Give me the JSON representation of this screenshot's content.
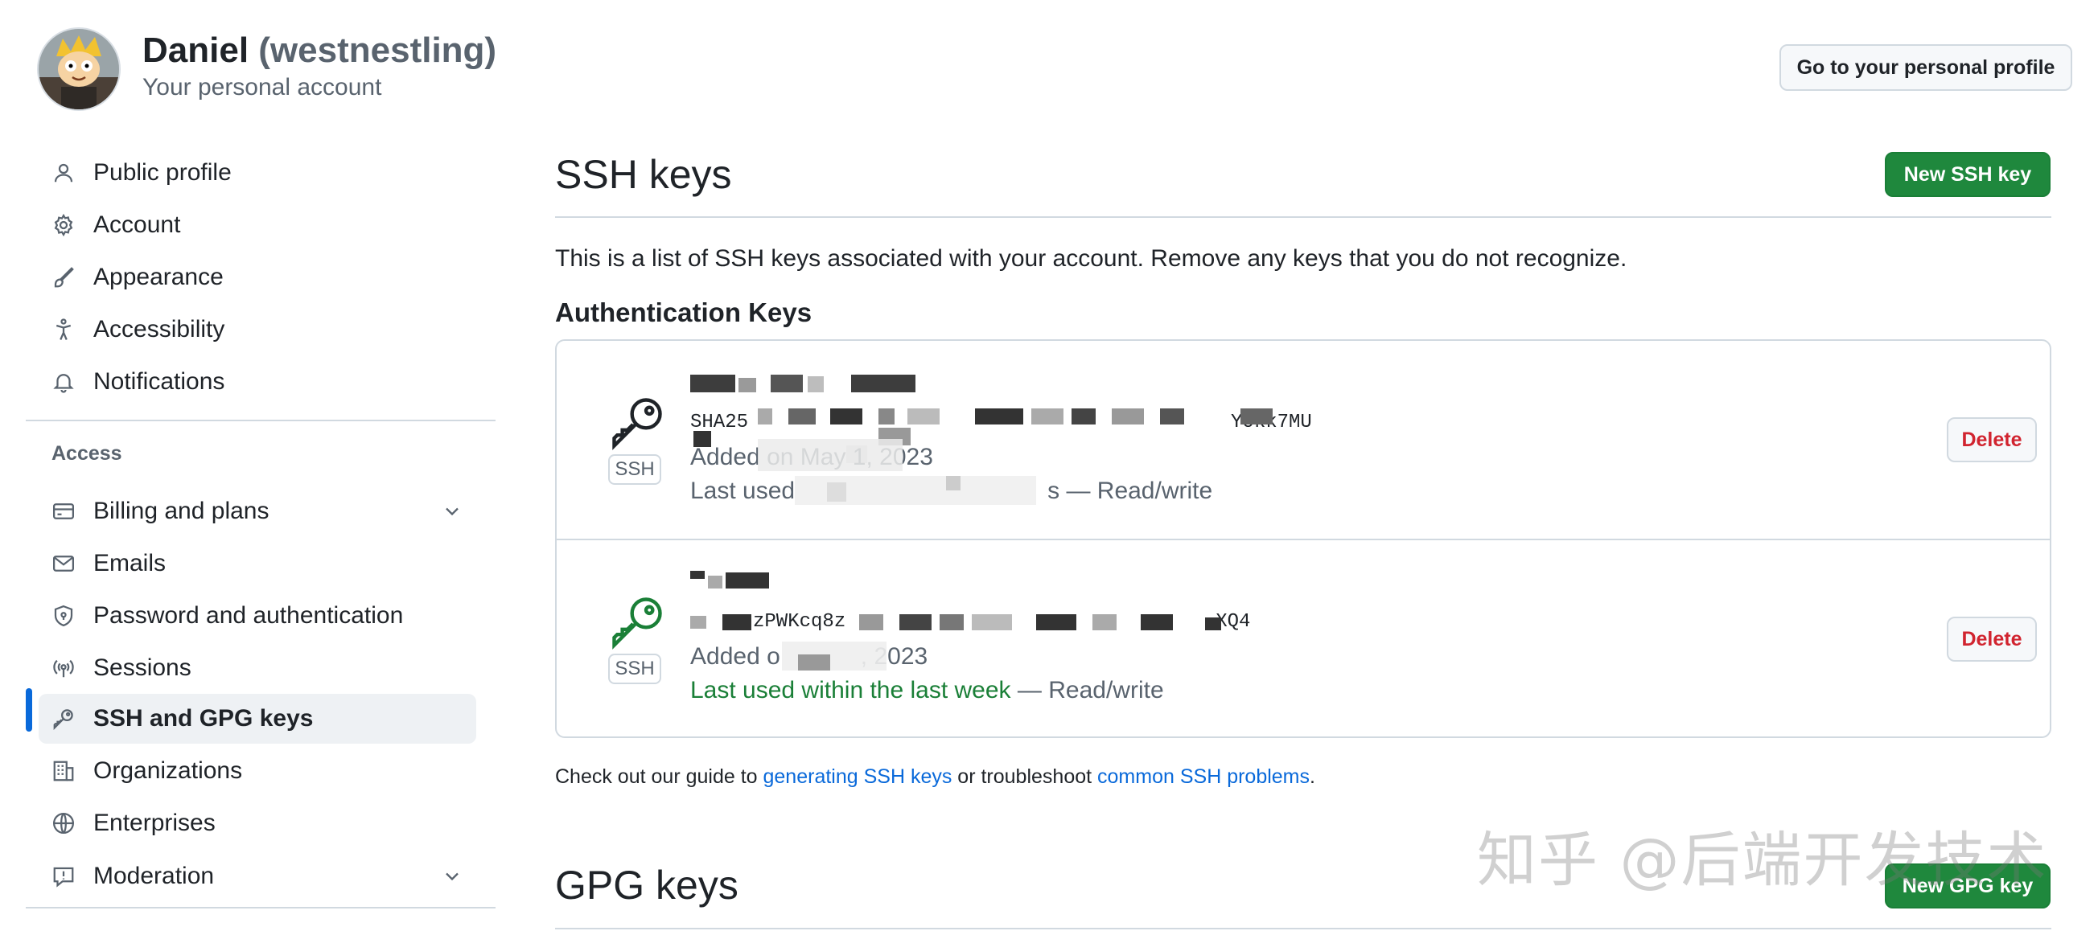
{
  "header": {
    "user_name": "Daniel",
    "user_handle": "(westnestling)",
    "account_type": "Your personal account",
    "profile_button": "Go to your personal profile"
  },
  "sidebar": {
    "items": [
      {
        "label": "Public profile",
        "icon": "person-icon"
      },
      {
        "label": "Account",
        "icon": "gear-icon"
      },
      {
        "label": "Appearance",
        "icon": "paintbrush-icon"
      },
      {
        "label": "Accessibility",
        "icon": "accessibility-icon"
      },
      {
        "label": "Notifications",
        "icon": "bell-icon"
      }
    ],
    "access_heading": "Access",
    "access_items": [
      {
        "label": "Billing and plans",
        "icon": "credit-card-icon"
      },
      {
        "label": "Emails",
        "icon": "mail-icon"
      },
      {
        "label": "Password and authentication",
        "icon": "shield-lock-icon"
      },
      {
        "label": "Sessions",
        "icon": "broadcast-icon"
      },
      {
        "label": "SSH and GPG keys",
        "icon": "key-icon"
      },
      {
        "label": "Organizations",
        "icon": "organization-icon"
      },
      {
        "label": "Enterprises",
        "icon": "globe-icon"
      },
      {
        "label": "Moderation",
        "icon": "report-icon"
      }
    ]
  },
  "main": {
    "ssh_title": "SSH keys",
    "new_ssh_button": "New SSH key",
    "description": "This is a list of SSH keys associated with your account. Remove any keys that you do not recognize.",
    "auth_heading": "Authentication Keys",
    "keys": [
      {
        "badge": "SSH",
        "fingerprint_visible": "SHA25",
        "fingerprint_tail": "Yokk7MU",
        "added": "Added on May 1, 2023",
        "last_used": "Last used",
        "last_used_tail": "s",
        "access": "— Read/write",
        "delete_label": "Delete"
      },
      {
        "badge": "SSH",
        "fingerprint_visible": "zPWKcq8z",
        "fingerprint_tail": "XQ4",
        "added": "Added o",
        "added_tail": ", 2023",
        "last_used": "Last used within the last week",
        "access": "— Read/write",
        "delete_label": "Delete"
      }
    ],
    "guide_prefix": "Check out our guide to ",
    "guide_link1": "generating SSH keys",
    "guide_middle": " or troubleshoot ",
    "guide_link2": "common SSH problems",
    "guide_suffix": ".",
    "gpg_title": "GPG keys",
    "new_gpg_button": "New GPG key"
  },
  "watermark": "知乎 @后端开发技术",
  "colors": {
    "primary_green": "#1f883d",
    "link_blue": "#0969da",
    "danger_red": "#d1242f",
    "recent_green": "#1a7f37",
    "muted_text": "#59636e",
    "border": "#d1d9e0"
  }
}
